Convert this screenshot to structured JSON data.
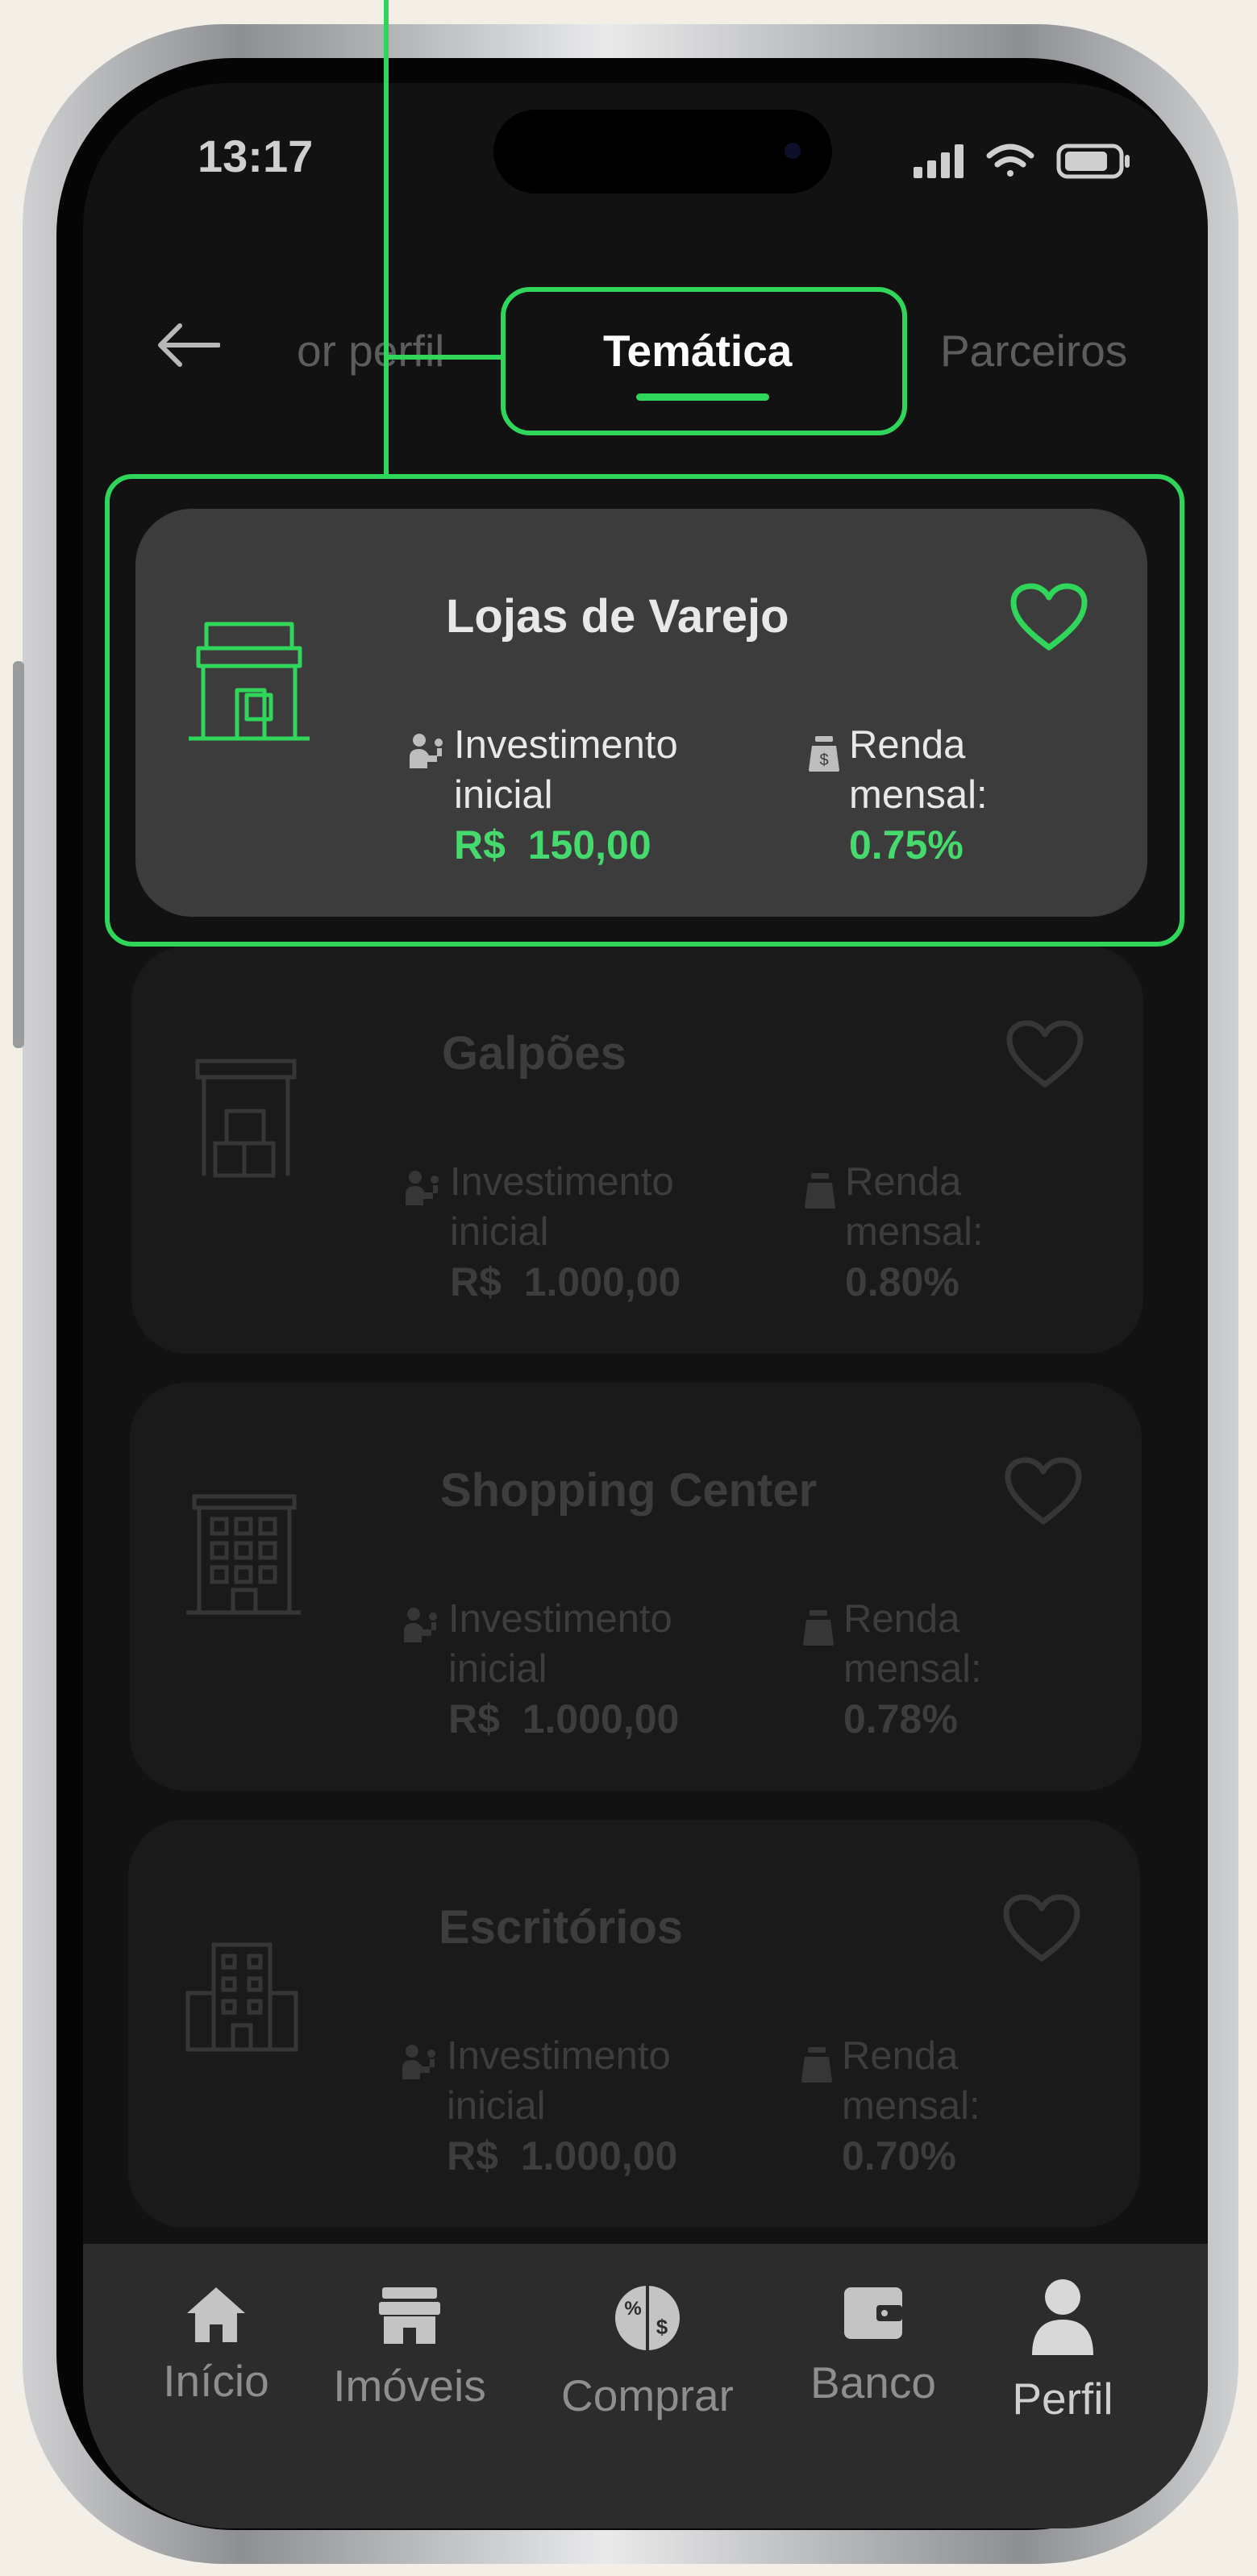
{
  "status_bar": {
    "time": "13:17"
  },
  "tabs": [
    {
      "label": "Por perfil",
      "visible_label": "or perfil"
    },
    {
      "label": "Temática",
      "active": true
    },
    {
      "label": "Parceiros"
    }
  ],
  "cards": [
    {
      "title": "Lojas de Varejo",
      "icon": "storefront-icon",
      "investment_label": "Investimento inicial",
      "investment_value": "R$  150,00",
      "income_label": "Renda mensal:",
      "income_value": "0.75%",
      "selected": true
    },
    {
      "title": "Galpões",
      "icon": "warehouse-icon",
      "investment_label": "Investimento inicial",
      "investment_value": "R$  1.000,00",
      "income_label": "Renda mensal:",
      "income_value": "0.80%"
    },
    {
      "title": "Shopping Center",
      "icon": "shopping-center-icon",
      "investment_label": "Investimento inicial",
      "investment_value": "R$  1.000,00",
      "income_label": "Renda mensal:",
      "income_value": "0.78%"
    },
    {
      "title": "Escritórios",
      "icon": "office-building-icon",
      "investment_label": "Investimento inicial",
      "investment_value": "R$  1.000,00",
      "income_label": "Renda mensal:",
      "income_value": "0.70%"
    }
  ],
  "bottom_nav": [
    {
      "label": "Início",
      "icon": "home-icon"
    },
    {
      "label": "Imóveis",
      "icon": "store-icon"
    },
    {
      "label": "Comprar",
      "icon": "buy-currency-icon"
    },
    {
      "label": "Banco",
      "icon": "wallet-icon"
    },
    {
      "label": "Perfil",
      "icon": "user-icon"
    }
  ],
  "colors": {
    "accent": "#2fd659",
    "value_green": "#46d96e",
    "screen_bg": "#121212",
    "card_active": "#3c3c3c",
    "card_dim": "#1a1a1a",
    "nav_bg": "#2c2c2c"
  }
}
